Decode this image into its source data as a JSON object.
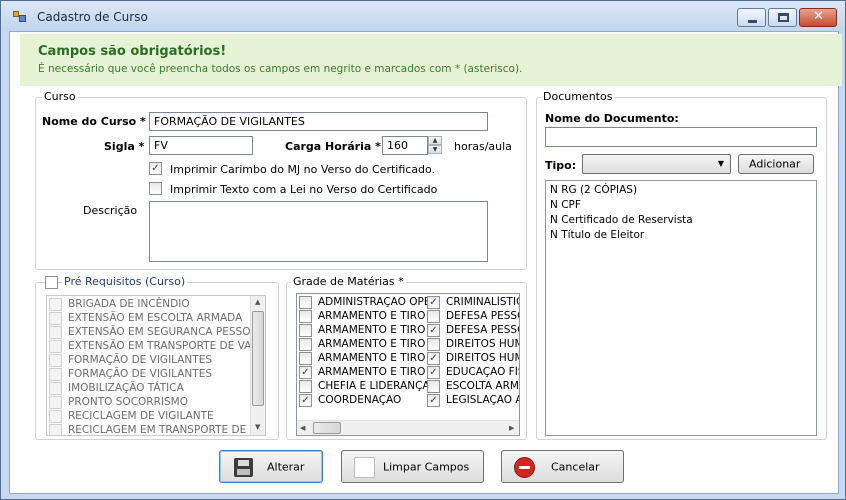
{
  "window": {
    "title": "Cadastro de Curso"
  },
  "banner": {
    "heading": "Campos são obrigatórios!",
    "text": "É necessário que você preencha todos os campos em negrito e marcados com * (asterisco)."
  },
  "curso": {
    "group_title": "Curso",
    "nome_label": "Nome do Curso *",
    "nome_value": "FORMAÇÃO DE VIGILANTES",
    "sigla_label": "Sigla *",
    "sigla_value": "FV",
    "carga_label": "Carga Horária *",
    "carga_value": "160",
    "carga_unit": "horas/aula",
    "check_carimbo": {
      "label": "Imprimir Carimbo do MJ no Verso do Certificado.",
      "checked": true
    },
    "check_lei": {
      "label": "Imprimir Texto com a Lei no Verso do Certificado",
      "checked": false
    },
    "descricao_label": "Descrição",
    "descricao_value": ""
  },
  "prereq": {
    "title": "Pré Requisitos (Curso)",
    "checked": false,
    "items": [
      "BRIGADA DE INCÊNDIO",
      "EXTENSÃO EM ESCOLTA ARMADA",
      "EXTENSÃO EM SEGURANCA PESSOAL",
      "EXTENSÃO EM TRANSPORTE DE VALORES",
      "FORMAÇÃO DE VIGILANTES",
      "FORMAÇÃO DE VIGILANTES",
      "IMOBILIZAÇÃO TÁTICA",
      "PRONTO SOCORRISMO",
      "RECICLAGEM DE VIGILANTE",
      "RECICLAGEM EM TRANSPORTE DE VALORES"
    ]
  },
  "grade": {
    "title": "Grade de Matérias *",
    "col1": [
      {
        "label": "ADMINISTRAÇÃO OPERACIONAL",
        "checked": false
      },
      {
        "label": "ARMAMENTO E TIRO",
        "checked": false
      },
      {
        "label": "ARMAMENTO E TIRO",
        "checked": false
      },
      {
        "label": "ARMAMENTO E TIRO",
        "checked": false
      },
      {
        "label": "ARMAMENTO E TIRO",
        "checked": false
      },
      {
        "label": "ARMAMENTO E TIRO",
        "checked": true
      },
      {
        "label": "CHEFIA E LIDERANÇA",
        "checked": false
      },
      {
        "label": "COORDENAÇÃO",
        "checked": true
      }
    ],
    "col2": [
      {
        "label": "CRIMINALÍSTICA",
        "checked": true
      },
      {
        "label": "DEFESA PESSOAL",
        "checked": false
      },
      {
        "label": "DEFESA PESSOAL",
        "checked": true
      },
      {
        "label": "DIREITOS HUMANOS",
        "checked": false
      },
      {
        "label": "DIREITOS HUMANOS",
        "checked": true
      },
      {
        "label": "EDUCAÇÃO FÍSICA",
        "checked": true
      },
      {
        "label": "ESCOLTA ARMADA",
        "checked": false
      },
      {
        "label": "LEGISLAÇÃO APLICADA",
        "checked": true
      }
    ]
  },
  "documentos": {
    "group_title": "Documentos",
    "nome_label": "Nome do Documento:",
    "nome_value": "",
    "tipo_label": "Tipo:",
    "tipo_value": "",
    "add_label": "Adicionar",
    "items": [
      "N RG (2 CÓPIAS)",
      "N CPF",
      "N Certificado de Reservista",
      "N Título de Eleitor"
    ]
  },
  "buttons": {
    "alterar": "Alterar",
    "limpar": "Limpar Campos",
    "cancelar": "Cancelar"
  },
  "icons": {
    "window": "form-icon",
    "alterar": "floppy-disk-icon",
    "limpar": "blank-page-icon",
    "cancelar": "no-entry-icon",
    "check_color": "#2b3f63",
    "banner_color": "#e6f3d4"
  }
}
